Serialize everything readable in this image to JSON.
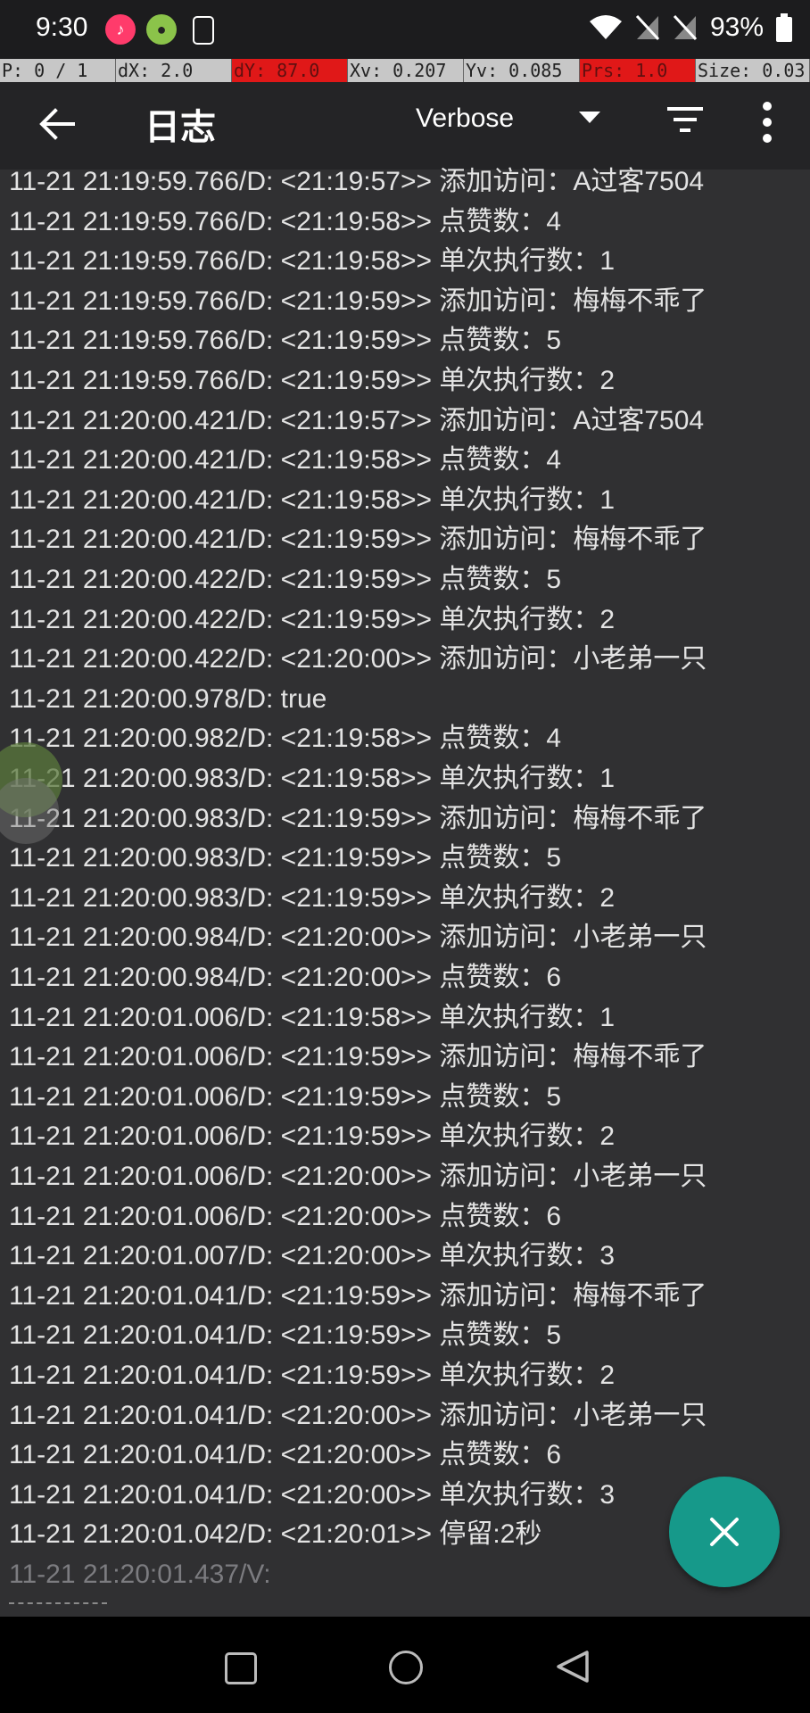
{
  "status_bar": {
    "time": "9:30",
    "battery": "93%",
    "left_icons": [
      "tiktok-icon",
      "app-icon",
      "screenshot-icon"
    ],
    "right_icons": [
      "wifi-icon",
      "signal-off-icon",
      "signal-off-icon",
      "battery-icon"
    ]
  },
  "debug_overlay": {
    "p": "P: 0 / 1",
    "dx": "dX: 2.0",
    "dy": "dY: 87.0",
    "xv": "Xv: 0.207",
    "yv": "Yv: 0.085",
    "prs": "Prs: 1.0",
    "size": "Size: 0.03"
  },
  "toolbar": {
    "title": "日志",
    "level": "Verbose"
  },
  "logs": [
    "11-21 21:19:59.766/D: <21:19:57>> 添加访问：A过客7504",
    "11-21 21:19:59.766/D: <21:19:58>> 点赞数：4",
    "11-21 21:19:59.766/D: <21:19:58>> 单次执行数：1",
    "11-21 21:19:59.766/D: <21:19:59>> 添加访问：梅梅不乖了",
    "11-21 21:19:59.766/D: <21:19:59>> 点赞数：5",
    "11-21 21:19:59.766/D: <21:19:59>> 单次执行数：2",
    "11-21 21:20:00.421/D: <21:19:57>> 添加访问：A过客7504",
    "11-21 21:20:00.421/D: <21:19:58>> 点赞数：4",
    "11-21 21:20:00.421/D: <21:19:58>> 单次执行数：1",
    "11-21 21:20:00.421/D: <21:19:59>> 添加访问：梅梅不乖了",
    "11-21 21:20:00.422/D: <21:19:59>> 点赞数：5",
    "11-21 21:20:00.422/D: <21:19:59>> 单次执行数：2",
    "11-21 21:20:00.422/D: <21:20:00>> 添加访问：小老弟一只",
    "11-21 21:20:00.978/D: true",
    "11-21 21:20:00.982/D: <21:19:58>> 点赞数：4",
    "11-21 21:20:00.983/D: <21:19:58>> 单次执行数：1",
    "11-21 21:20:00.983/D: <21:19:59>> 添加访问：梅梅不乖了",
    "11-21 21:20:00.983/D: <21:19:59>> 点赞数：5",
    "11-21 21:20:00.983/D: <21:19:59>> 单次执行数：2",
    "11-21 21:20:00.984/D: <21:20:00>> 添加访问：小老弟一只",
    "11-21 21:20:00.984/D: <21:20:00>> 点赞数：6",
    "11-21 21:20:01.006/D: <21:19:58>> 单次执行数：1",
    "11-21 21:20:01.006/D: <21:19:59>> 添加访问：梅梅不乖了",
    "11-21 21:20:01.006/D: <21:19:59>> 点赞数：5",
    "11-21 21:20:01.006/D: <21:19:59>> 单次执行数：2",
    "11-21 21:20:01.006/D: <21:20:00>> 添加访问：小老弟一只",
    "11-21 21:20:01.006/D: <21:20:00>> 点赞数：6",
    "11-21 21:20:01.007/D: <21:20:00>> 单次执行数：3",
    "11-21 21:20:01.041/D: <21:19:59>> 添加访问：梅梅不乖了",
    "11-21 21:20:01.041/D: <21:19:59>> 点赞数：5",
    "11-21 21:20:01.041/D: <21:19:59>> 单次执行数：2",
    "11-21 21:20:01.041/D: <21:20:00>> 添加访问：小老弟一只",
    "11-21 21:20:01.041/D: <21:20:00>> 点赞数：6",
    "11-21 21:20:01.041/D: <21:20:00>> 单次执行数：3",
    "11-21 21:20:01.042/D: <21:20:01>> 停留:2秒",
    "11-21 21:20:01.437/V:"
  ],
  "fab": {
    "icon": "close-icon"
  },
  "nav_bar": {
    "icons": [
      "recents-icon",
      "home-icon",
      "back-icon"
    ]
  }
}
